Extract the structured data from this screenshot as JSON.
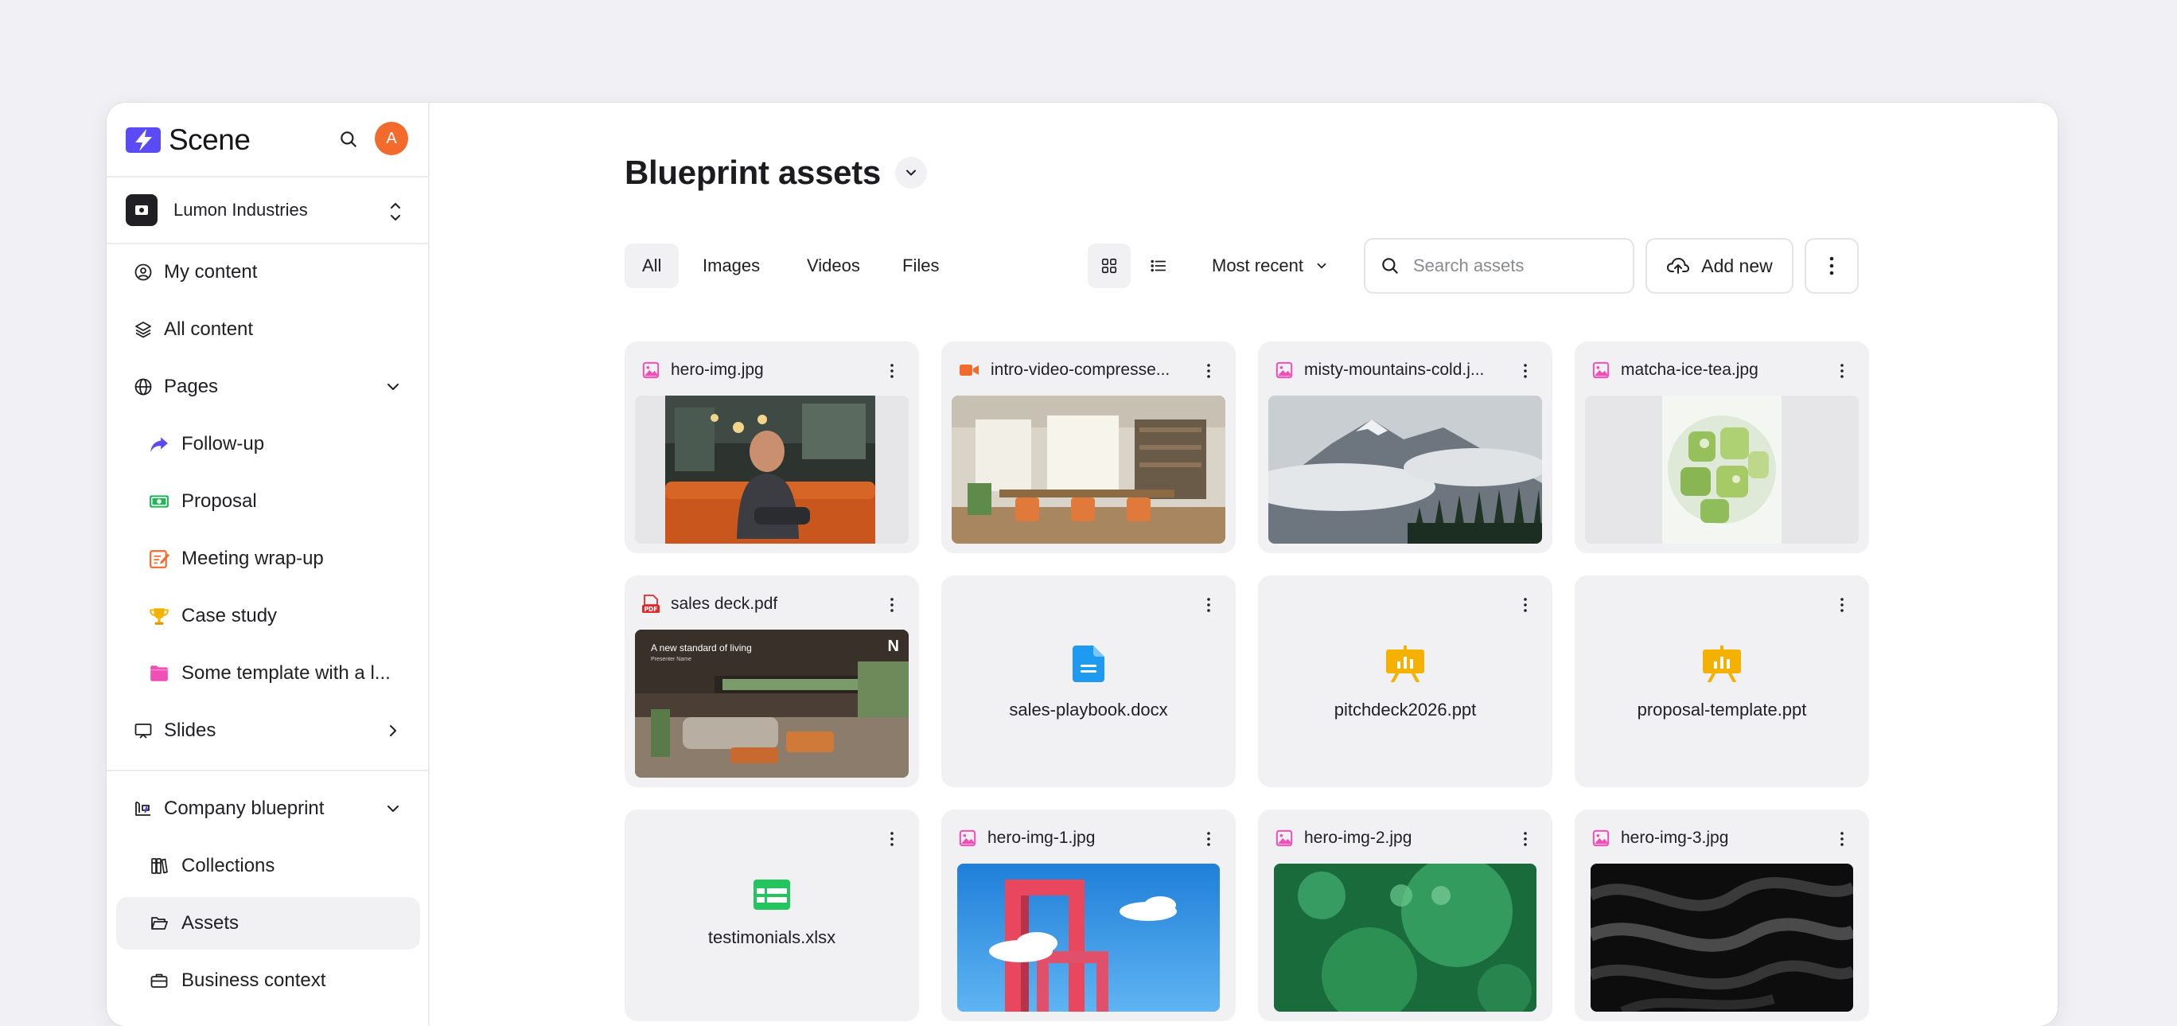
{
  "app": {
    "brand": "Scene",
    "avatar_initial": "A"
  },
  "org": {
    "name": "Lumon Industries"
  },
  "nav": {
    "my_content": "My content",
    "all_content": "All content",
    "pages": "Pages",
    "follow_up": "Follow-up",
    "proposal": "Proposal",
    "meeting_wrap_up": "Meeting wrap-up",
    "case_study": "Case study",
    "some_template": "Some template with a l...",
    "slides": "Slides",
    "company_blueprint": "Company blueprint",
    "collections": "Collections",
    "assets": "Assets",
    "business_context": "Business context"
  },
  "header": {
    "title": "Blueprint assets"
  },
  "filters": {
    "all": "All",
    "images": "Images",
    "videos": "Videos",
    "files": "Files"
  },
  "sort": {
    "label": "Most recent"
  },
  "search": {
    "placeholder": "Search assets"
  },
  "actions": {
    "add_new": "Add new"
  },
  "assets": [
    {
      "name": "hero-img.jpg",
      "kind": "image"
    },
    {
      "name": "intro-video-compresse...",
      "kind": "video"
    },
    {
      "name": "misty-mountains-cold.j...",
      "kind": "image"
    },
    {
      "name": "matcha-ice-tea.jpg",
      "kind": "image"
    },
    {
      "name": "sales deck.pdf",
      "kind": "pdf",
      "preview_heading": "A new standard of living",
      "preview_sub": "Presenter Name",
      "preview_logo": "N"
    },
    {
      "name": "sales-playbook.docx",
      "kind": "doc"
    },
    {
      "name": "pitchdeck2026.ppt",
      "kind": "ppt"
    },
    {
      "name": "proposal-template.ppt",
      "kind": "ppt"
    },
    {
      "name": "testimonials.xlsx",
      "kind": "xls"
    },
    {
      "name": "hero-img-1.jpg",
      "kind": "image"
    },
    {
      "name": "hero-img-2.jpg",
      "kind": "image"
    },
    {
      "name": "hero-img-3.jpg",
      "kind": "image"
    }
  ],
  "colors": {
    "brand": "#5b4bf5",
    "avatar": "#f26b2c",
    "image_icon": "#ef4fb6",
    "video_icon": "#f26b2c",
    "pdf_icon": "#e02b2b",
    "doc_icon": "#1e9bf0",
    "ppt_icon": "#f5b100",
    "xls_icon": "#22c55e"
  }
}
